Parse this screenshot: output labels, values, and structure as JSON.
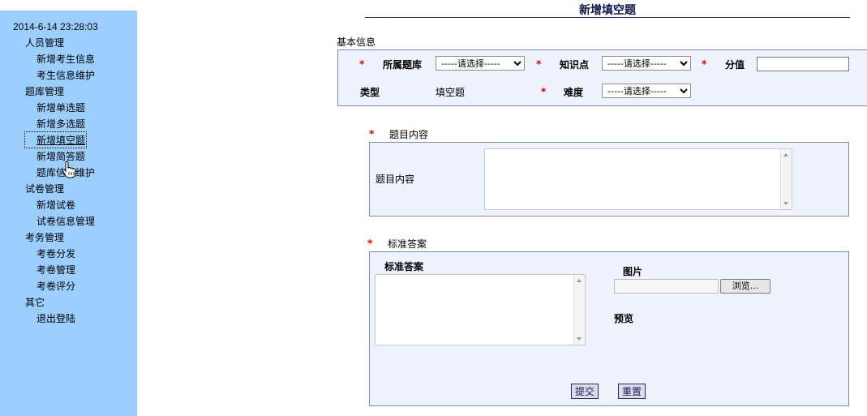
{
  "sidebar": {
    "timestamp": "2014-6-14 23:28:03",
    "nav": [
      {
        "label": "人员管理",
        "level": "section"
      },
      {
        "label": "新增考生信息",
        "level": "item"
      },
      {
        "label": "考生信息维护",
        "level": "item"
      },
      {
        "label": "题库管理",
        "level": "section"
      },
      {
        "label": "新增单选题",
        "level": "item"
      },
      {
        "label": "新增多选题",
        "level": "item"
      },
      {
        "label": "新增填空题",
        "level": "item",
        "active": true
      },
      {
        "label": "新增简答题",
        "level": "item"
      },
      {
        "label": "题库信息维护",
        "level": "item"
      },
      {
        "label": "试卷管理",
        "level": "section"
      },
      {
        "label": "新增试卷",
        "level": "item"
      },
      {
        "label": "试卷信息管理",
        "level": "item"
      },
      {
        "label": "考务管理",
        "level": "section"
      },
      {
        "label": "考卷分发",
        "level": "item"
      },
      {
        "label": "考卷管理",
        "level": "item"
      },
      {
        "label": "考卷评分",
        "level": "item"
      },
      {
        "label": "其它",
        "level": "section"
      },
      {
        "label": "退出登陆",
        "level": "item"
      }
    ]
  },
  "page": {
    "title": "新增填空题"
  },
  "basic": {
    "section_label": "基本信息",
    "required_mark": "*",
    "bank_label": "所属题库",
    "bank_value": "-----请选择-----",
    "knowledge_label": "知识点",
    "knowledge_value": "-----请选择-----",
    "score_label": "分值",
    "score_value": "",
    "type_label": "类型",
    "type_value": "填空题",
    "difficulty_label": "难度",
    "difficulty_value": "-----请选择-----"
  },
  "content": {
    "section_label": "题目内容",
    "field_label": "题目内容",
    "value": ""
  },
  "answer": {
    "section_label": "标准答案",
    "field_label": "标准答案",
    "value": "",
    "image_label": "图片",
    "browse_label": "浏览...",
    "preview_label": "预览",
    "submit_label": "提交",
    "reset_label": "重置"
  }
}
